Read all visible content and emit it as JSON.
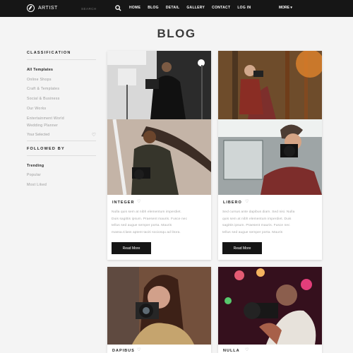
{
  "header": {
    "logo_text": "ARTIST",
    "search_placeholder": "SEARCH",
    "nav": [
      "HOME",
      "BLOG",
      "DETAIL",
      "GALLERY",
      "CONTACT",
      "LOG IN"
    ],
    "more": "MORE ▾"
  },
  "page": {
    "title": "BLOG"
  },
  "sidebar": {
    "classification_title": "CLASSIFICATION",
    "classification_items": [
      "All Templates",
      "Online Shops",
      "Craft & Templates",
      "Social & Business",
      "Our Works",
      "Entertainment World",
      "Wedding Planner"
    ],
    "selected_label": "Your Selected",
    "followed_title": "FOLLOWED BY",
    "followed_items": [
      "Trending",
      "Popular",
      "Most Liked"
    ]
  },
  "posts": [
    {
      "title": "INTEGER",
      "text": [
        "Nulla quis sem at nibh elementum imperdiet.",
        "Duis sagittis ipsum. Praesent mauris. Fusce nec",
        "tellus sed augue semper porta. Mauris",
        "massa.Class aptent taciti sociosqu ad litora."
      ],
      "button": "Read More"
    },
    {
      "title": "LIBERO",
      "text": [
        "Sed cursus ante dapibus diam. Sed nisi. Nulla",
        "quis sem at nibh elementum imperdiet. Duis",
        "sagittis ipsum. Praesent mauris. Fusce nec",
        "tellus sed augue semper porta. Mauris"
      ],
      "button": "Read More"
    },
    {
      "title": "DAPIBUS"
    },
    {
      "title": "NULLA"
    }
  ],
  "colors": {
    "topbar": "#161616",
    "button": "#151515",
    "background": "#f4f4f4"
  }
}
